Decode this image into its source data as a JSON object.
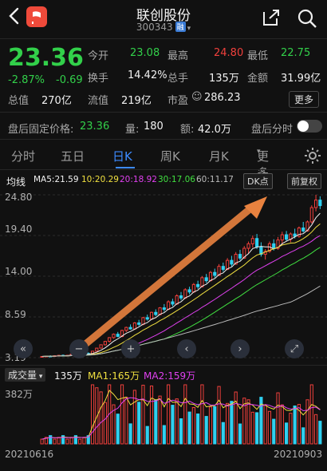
{
  "header": {
    "title": "联创股份",
    "code": "300343",
    "badge": "融"
  },
  "quote": {
    "price": "23.36",
    "change_pct": "-2.87%",
    "change": "-0.69",
    "fields": [
      {
        "label": "今开",
        "value": "23.08",
        "color": "green"
      },
      {
        "label": "最高",
        "value": "24.80",
        "color": "red"
      },
      {
        "label": "最低",
        "value": "22.75",
        "color": "green"
      },
      {
        "label": "换手",
        "value": "14.42%",
        "color": "white"
      },
      {
        "label": "总手",
        "value": "135万",
        "color": "white"
      },
      {
        "label": "金额",
        "value": "31.99亿",
        "color": "white"
      },
      {
        "label": "总值",
        "value": "270亿",
        "color": "white"
      },
      {
        "label": "流值",
        "value": "219亿",
        "color": "white"
      },
      {
        "label": "市盈",
        "value": "286.23",
        "color": "white"
      }
    ],
    "more_label": "更多",
    "after_hours": {
      "label": "盘后固定价格:",
      "price": "23.36",
      "vol_label": "量:",
      "vol": "180",
      "amt_label": "额:",
      "amt": "42.0万",
      "toggle_label": "盘后分时"
    }
  },
  "tabs": [
    "分时",
    "五日",
    "日K",
    "周K",
    "月K",
    "更多"
  ],
  "active_tab": "日K",
  "ma_bar": {
    "label": "均线",
    "ma5": "MA5:21.59",
    "ma10": "10:20.29",
    "ma20": "20:18.92",
    "ma30": "30:17.06",
    "ma60": "60:11.17",
    "dk_label": "DK点",
    "fq_label": "前复权"
  },
  "y_axis": [
    "24.80",
    "19.40",
    "14.00",
    "8.59",
    "3.19"
  ],
  "volume_bar": {
    "label": "成交量",
    "vol": "135万",
    "ma1": "MA1:165万",
    "ma2": "MA2:159万",
    "max_label": "382万"
  },
  "dates": {
    "start": "20210616",
    "end": "20210903"
  },
  "colors": {
    "up": "#f0403c",
    "down": "#2fd0f0",
    "accent": "#e8823f",
    "ma5": "#f2f2f2",
    "ma10": "#f0e040",
    "ma20": "#e040f0",
    "ma30": "#40e040",
    "ma60": "#bbbbbb"
  },
  "chart_data": {
    "type": "candlestick",
    "ylim": [
      3.19,
      24.8
    ],
    "ohlc": [
      [
        3.3,
        3.4,
        3.2,
        3.35
      ],
      [
        3.35,
        3.45,
        3.3,
        3.4
      ],
      [
        3.4,
        3.5,
        3.3,
        3.35
      ],
      [
        3.35,
        3.5,
        3.3,
        3.45
      ],
      [
        3.45,
        3.55,
        3.4,
        3.5
      ],
      [
        3.5,
        3.6,
        3.4,
        3.45
      ],
      [
        3.45,
        3.55,
        3.4,
        3.5
      ],
      [
        3.5,
        3.7,
        3.45,
        3.65
      ],
      [
        3.65,
        3.75,
        3.5,
        3.55
      ],
      [
        3.55,
        3.7,
        3.5,
        3.65
      ],
      [
        3.65,
        3.8,
        3.6,
        3.75
      ],
      [
        3.75,
        3.9,
        3.6,
        3.7
      ],
      [
        3.7,
        4.1,
        3.65,
        4.05
      ],
      [
        4.05,
        4.5,
        4.0,
        4.45
      ],
      [
        4.45,
        4.9,
        4.4,
        4.9
      ],
      [
        4.9,
        5.4,
        4.8,
        5.35
      ],
      [
        5.35,
        5.9,
        5.2,
        5.85
      ],
      [
        5.85,
        6.4,
        5.7,
        6.3
      ],
      [
        6.3,
        6.6,
        5.9,
        6.0
      ],
      [
        6.0,
        6.9,
        5.9,
        6.8
      ],
      [
        6.8,
        7.3,
        6.6,
        7.2
      ],
      [
        7.2,
        7.6,
        6.9,
        7.0
      ],
      [
        7.0,
        7.9,
        6.9,
        7.8
      ],
      [
        7.8,
        8.2,
        7.4,
        7.6
      ],
      [
        7.6,
        8.6,
        7.5,
        8.5
      ],
      [
        8.5,
        8.9,
        8.1,
        8.3
      ],
      [
        8.3,
        9.3,
        8.2,
        9.2
      ],
      [
        9.2,
        9.6,
        8.7,
        8.9
      ],
      [
        8.9,
        9.9,
        8.8,
        9.8
      ],
      [
        9.8,
        10.3,
        9.3,
        9.6
      ],
      [
        9.6,
        10.8,
        9.5,
        10.6
      ],
      [
        10.6,
        11.0,
        10.0,
        10.3
      ],
      [
        10.3,
        11.6,
        10.2,
        11.4
      ],
      [
        11.4,
        11.9,
        10.8,
        11.1
      ],
      [
        11.1,
        12.4,
        11.0,
        12.2
      ],
      [
        12.2,
        12.6,
        11.6,
        11.9
      ],
      [
        11.9,
        13.1,
        11.8,
        12.9
      ],
      [
        12.9,
        13.4,
        12.3,
        12.6
      ],
      [
        12.6,
        14.0,
        12.5,
        13.8
      ],
      [
        13.8,
        14.3,
        13.1,
        13.4
      ],
      [
        13.4,
        14.7,
        13.3,
        14.5
      ],
      [
        14.5,
        15.0,
        13.8,
        14.1
      ],
      [
        14.1,
        15.6,
        14.0,
        15.3
      ],
      [
        15.3,
        15.8,
        14.6,
        14.9
      ],
      [
        14.9,
        16.4,
        14.8,
        16.1
      ],
      [
        16.1,
        16.7,
        15.3,
        15.6
      ],
      [
        15.6,
        17.2,
        15.5,
        16.9
      ],
      [
        16.9,
        17.5,
        16.1,
        16.4
      ],
      [
        16.4,
        18.0,
        16.3,
        17.7
      ],
      [
        17.7,
        18.6,
        17.0,
        18.3
      ],
      [
        18.3,
        19.4,
        17.8,
        19.0
      ],
      [
        19.0,
        19.6,
        17.6,
        17.9
      ],
      [
        17.9,
        18.5,
        16.6,
        16.9
      ],
      [
        16.9,
        17.6,
        16.2,
        17.3
      ],
      [
        17.3,
        18.6,
        17.1,
        18.3
      ],
      [
        18.3,
        18.9,
        17.4,
        17.7
      ],
      [
        17.7,
        19.2,
        17.5,
        18.8
      ],
      [
        18.8,
        19.9,
        18.2,
        19.5
      ],
      [
        19.5,
        20.0,
        18.6,
        18.9
      ],
      [
        18.9,
        19.8,
        18.5,
        19.6
      ],
      [
        19.6,
        20.3,
        19.0,
        19.3
      ],
      [
        19.3,
        20.6,
        19.1,
        20.4
      ],
      [
        20.4,
        21.2,
        19.8,
        20.0
      ],
      [
        20.0,
        21.4,
        19.9,
        21.2
      ],
      [
        21.2,
        23.4,
        21.0,
        23.1
      ],
      [
        23.1,
        24.8,
        22.6,
        24.1
      ],
      [
        24.1,
        24.6,
        22.9,
        23.36
      ]
    ],
    "volume_max_label": "382万"
  }
}
